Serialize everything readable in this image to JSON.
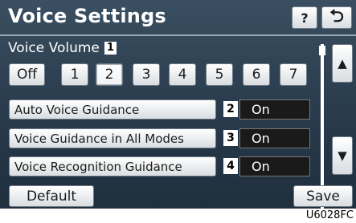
{
  "header": {
    "title": "Voice Settings",
    "help_label": "?",
    "back_label": "⮌"
  },
  "volume": {
    "label": "Voice Volume",
    "badge": "1",
    "options": [
      "Off",
      "1",
      "2",
      "3",
      "4",
      "5",
      "6",
      "7"
    ],
    "selected": "2"
  },
  "settings": [
    {
      "label": "Auto Voice Guidance",
      "badge": "2",
      "value": "On"
    },
    {
      "label": "Voice Guidance in All Modes",
      "badge": "3",
      "value": "On"
    },
    {
      "label": "Voice Recognition Guidance",
      "badge": "4",
      "value": "On"
    }
  ],
  "scroll": {
    "up_label": "▲",
    "down_label": "▼"
  },
  "footer": {
    "default_label": "Default",
    "save_label": "Save",
    "image_code": "U6028FC"
  }
}
